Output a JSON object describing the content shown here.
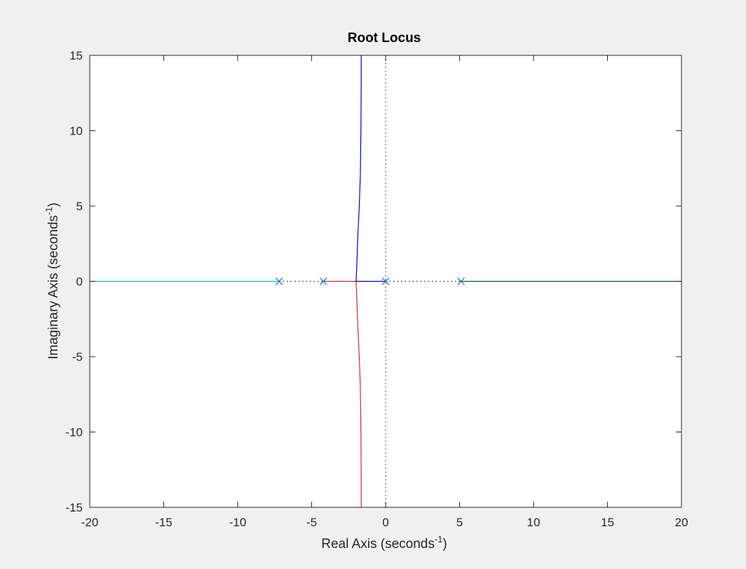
{
  "chart_data": {
    "type": "line",
    "title": "Root Locus",
    "xlabel": {
      "text": "Real Axis (seconds",
      "sup": "-1",
      "tail": ")"
    },
    "ylabel": {
      "text": "Imaginary Axis (seconds",
      "sup": "-1",
      "tail": ")"
    },
    "xlim": [
      -20,
      20
    ],
    "ylim": [
      -15,
      15
    ],
    "xticks": [
      -20,
      -15,
      -10,
      -5,
      0,
      5,
      10,
      15,
      20
    ],
    "yticks": [
      -15,
      -10,
      -5,
      0,
      5,
      10,
      15
    ],
    "xtick_labels": [
      "-20",
      "-15",
      "-10",
      "-5",
      "0",
      "5",
      "10",
      "15",
      "20"
    ],
    "ytick_labels": [
      "-15",
      "-10",
      "-5",
      "0",
      "5",
      "10",
      "15"
    ],
    "grid": false,
    "poles": [
      {
        "x": -7.2,
        "y": 0
      },
      {
        "x": -4.2,
        "y": 0
      },
      {
        "x": 0,
        "y": 0
      },
      {
        "x": 5.1,
        "y": 0
      }
    ],
    "series": [
      {
        "color": "#00bfbf",
        "x": [
          -7.2,
          -20
        ],
        "y": [
          0,
          0
        ]
      },
      {
        "color": "#d62728",
        "x": [
          -4.2,
          -3.0,
          -2.0,
          -1.95,
          -1.88,
          -1.78,
          -1.71,
          -1.67,
          -1.65,
          -1.65
        ],
        "y": [
          0,
          0,
          0,
          -1,
          -3,
          -5,
          -7,
          -10,
          -13,
          -15
        ]
      },
      {
        "color": "#0000cc",
        "x": [
          0,
          -1.0,
          -2.0,
          -1.95,
          -1.88,
          -1.78,
          -1.71,
          -1.67,
          -1.65,
          -1.65
        ],
        "y": [
          0,
          0,
          0,
          1,
          3,
          5,
          7,
          10,
          13,
          15
        ]
      },
      {
        "color": "#006400",
        "x": [
          5.1,
          20
        ],
        "y": [
          0,
          0
        ]
      }
    ],
    "gap_segments": [
      {
        "x": [
          -7.2,
          -4.2
        ],
        "y": [
          0,
          0
        ]
      },
      {
        "x": [
          0,
          5.1
        ],
        "y": [
          0,
          0
        ]
      }
    ],
    "reference_lines": {
      "x0": true,
      "y0": true
    },
    "pole_marker_color": "#0072bd",
    "axes_color": "#262626"
  }
}
